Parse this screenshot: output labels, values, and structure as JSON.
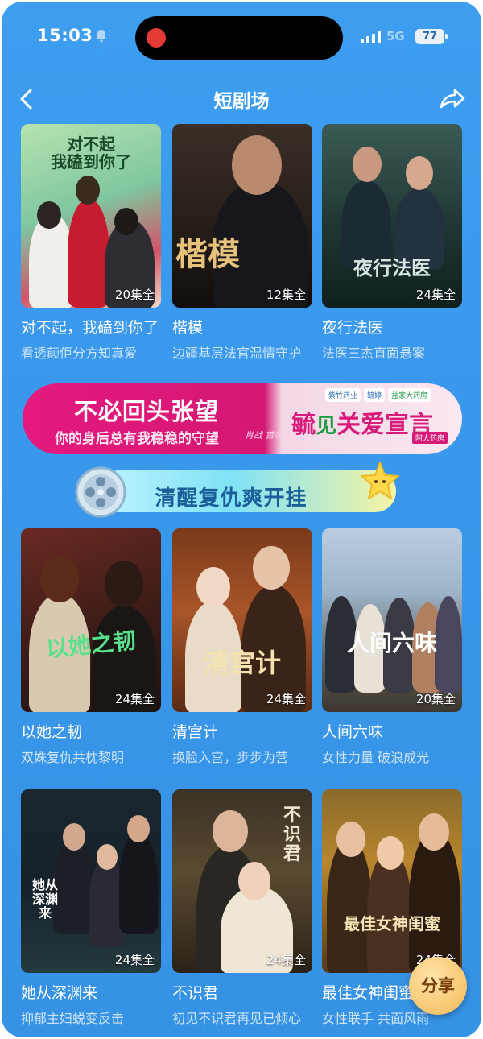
{
  "status_bar": {
    "time": "15:03",
    "network": "5G",
    "battery": "77"
  },
  "nav": {
    "title": "短剧场"
  },
  "dramas_top": [
    {
      "title": "对不起，我磕到你了",
      "poster_text": "对不起\n我磕到你了",
      "episodes": "20集全",
      "desc": "看透颠佢分方知真爱"
    },
    {
      "title": "楷模",
      "poster_text": "楷模",
      "episodes": "12集全",
      "desc": "边疆基层法官温情守护"
    },
    {
      "title": "夜行法医",
      "poster_text": "夜行法医",
      "episodes": "24集全",
      "desc": "法医三杰直面悬案"
    }
  ],
  "banner": {
    "main_text": "不必回头张望",
    "sub_text": "你的身后总有我稳稳的守望",
    "signature": "肖战 首席官",
    "right_text_1": "毓",
    "right_text_2": "见",
    "right_text_3": "关爱宣言",
    "logo_1": "紫竹药业",
    "logo_2": "毓婷",
    "logo_3": "益家大药房",
    "tag": "阿大药房"
  },
  "section": {
    "title": "清醒复仇爽开挂"
  },
  "dramas_mid": [
    {
      "title": "以她之韧",
      "poster_text": "以她之韧",
      "episodes": "24集全",
      "desc": "双姝复仇共枕黎明"
    },
    {
      "title": "清宫计",
      "poster_text": "清宫计",
      "episodes": "24集全",
      "desc": "换脸入宫，步步为营"
    },
    {
      "title": "人间六味",
      "poster_text": "人间六味",
      "episodes": "20集全",
      "desc": "女性力量 破浪成光"
    }
  ],
  "dramas_bottom": [
    {
      "title": "她从深渊来",
      "poster_text": "她从\n深渊来",
      "episodes": "24集全",
      "desc": "抑郁主妇蜕变反击"
    },
    {
      "title": "不识君",
      "poster_text": "不识君",
      "episodes": "24集全",
      "desc": "初见不识君再见已倾心"
    },
    {
      "title": "最佳女神闺蜜",
      "poster_text": "最佳女神闺蜜",
      "episodes": "24集全",
      "desc": "女性联手 共面风雨"
    }
  ],
  "fab": {
    "label": "分享"
  },
  "colors": {
    "background": "#3a98ec",
    "banner_pink": "#e6197f",
    "accent_text": "#1b5e9a"
  },
  "icons": [
    "bell-icon",
    "signal-icon",
    "back-icon",
    "share-icon",
    "film-reel-icon",
    "star-icon"
  ]
}
